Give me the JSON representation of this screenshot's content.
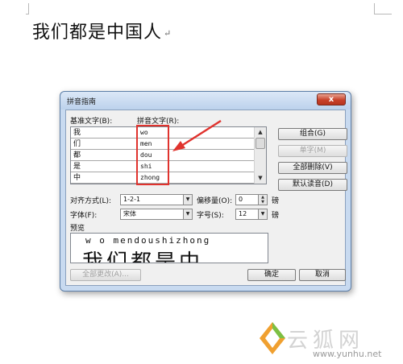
{
  "document": {
    "text": "我们都是中国人",
    "para_mark": "↵"
  },
  "dialog": {
    "title": "拼音指南",
    "close_label": "x",
    "base_text_label": "基准文字(B):",
    "ruby_text_label": "拼音文字(R):",
    "rows": [
      {
        "base": "我",
        "ruby": "wo"
      },
      {
        "base": "们",
        "ruby": "men"
      },
      {
        "base": "都",
        "ruby": "dou"
      },
      {
        "base": "是",
        "ruby": "shi"
      },
      {
        "base": "中",
        "ruby": "zhong"
      }
    ],
    "buttons": {
      "group": "组合(G)",
      "single": "单字(M)",
      "clear_all": "全部删除(V)",
      "default_reading": "默认读音(D)",
      "change_all": "全部更改(A)...",
      "ok": "确定",
      "cancel": "取消"
    },
    "alignment_label": "对齐方式(L):",
    "alignment_value": "1-2-1",
    "offset_label": "偏移量(O):",
    "offset_value": "0",
    "offset_unit": "磅",
    "font_label": "字体(F):",
    "font_value": "宋体",
    "size_label": "字号(S):",
    "size_value": "12",
    "size_unit": "磅",
    "preview_label": "预览",
    "preview_pinyin": "w o mendoushizhong",
    "preview_chars": "我们都是中"
  },
  "watermark": {
    "brand": "云狐网",
    "url": "www.yunhu.net"
  },
  "colors": {
    "highlight": "#e0332e",
    "arrow": "#e0332e",
    "dialog_frame": "#c8daf0"
  }
}
